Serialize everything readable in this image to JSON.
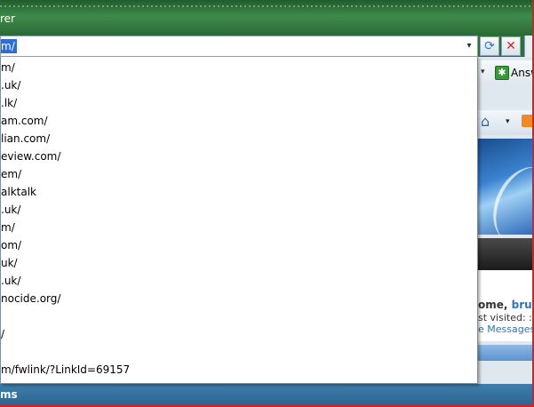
{
  "window": {
    "title_fragment": "rer"
  },
  "address_bar": {
    "value": "m/",
    "dropdown_arrow": "▾",
    "refresh_glyph": "⟳",
    "stop_glyph": "✕"
  },
  "suggestions": [
    "m/",
    ".uk/",
    ".lk/",
    "am.com/",
    "lian.com/",
    "eview.com/",
    "em/",
    "alktalk",
    ".uk/",
    "m/",
    "om/",
    "uk/",
    ".uk/",
    "nocide.org/",
    "",
    "/",
    "",
    "m/fwlink/?LinkId=69157"
  ],
  "right_panel": {
    "answers_label": "Answ",
    "answers_glyph": "✱",
    "home_glyph": "⌂",
    "welcome_prefix": "ome, ",
    "welcome_name": "brun",
    "last_visited": "st visited: :",
    "messages_link": "e Messages"
  },
  "bottom_bar": {
    "text": "ms"
  },
  "colors": {
    "selection": "#2f6fd4",
    "frame": "#e21b1b",
    "link": "#2f75b5"
  }
}
